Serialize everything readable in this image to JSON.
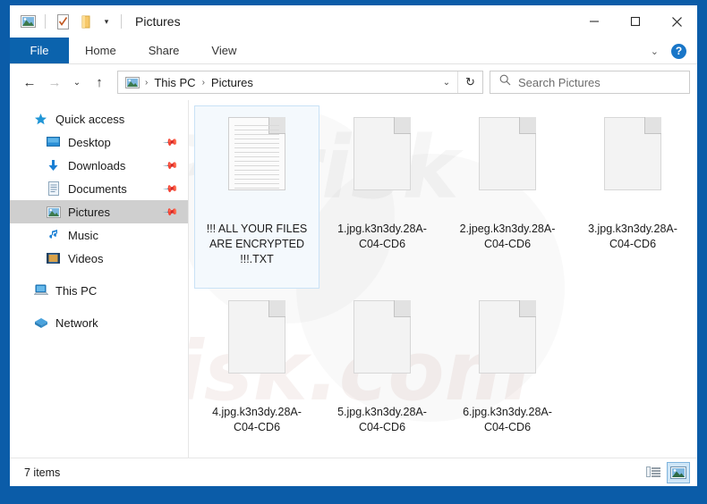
{
  "window": {
    "title": "Pictures",
    "border_color": "#0b5ca8",
    "accent_color": "#0b63ad"
  },
  "quick_access_toolbar": {
    "icons": [
      "pictures-folder-icon",
      "properties-icon",
      "new-folder-icon"
    ],
    "dropdown_glyph": "▾"
  },
  "window_controls": {
    "minimize": "minimize-icon",
    "maximize": "maximize-icon",
    "close": "close-icon"
  },
  "ribbon": {
    "tabs": [
      {
        "label": "File",
        "active": true
      },
      {
        "label": "Home",
        "active": false
      },
      {
        "label": "Share",
        "active": false
      },
      {
        "label": "View",
        "active": false
      }
    ],
    "collapse_glyph": "⌄",
    "help_label": "?"
  },
  "navigation": {
    "back_glyph": "←",
    "forward_glyph": "→",
    "recent_glyph": "⌄",
    "up_glyph": "↑",
    "refresh_glyph": "↻",
    "dropdown_glyph": "⌄"
  },
  "address_bar": {
    "icon": "pictures-folder-icon",
    "crumbs": [
      "This PC",
      "Pictures"
    ],
    "separator": "›"
  },
  "search": {
    "placeholder": "Search Pictures",
    "icon": "search-icon",
    "value": ""
  },
  "sidebar": {
    "items": [
      {
        "label": "Quick access",
        "icon": "star-icon",
        "pinned": false,
        "selected": false,
        "indent": false
      },
      {
        "label": "Desktop",
        "icon": "desktop-icon",
        "pinned": true,
        "selected": false,
        "indent": true
      },
      {
        "label": "Downloads",
        "icon": "downloads-icon",
        "pinned": true,
        "selected": false,
        "indent": true
      },
      {
        "label": "Documents",
        "icon": "documents-icon",
        "pinned": true,
        "selected": false,
        "indent": true
      },
      {
        "label": "Pictures",
        "icon": "pictures-icon",
        "pinned": true,
        "selected": true,
        "indent": true
      },
      {
        "label": "Music",
        "icon": "music-icon",
        "pinned": false,
        "selected": false,
        "indent": true
      },
      {
        "label": "Videos",
        "icon": "videos-icon",
        "pinned": false,
        "selected": false,
        "indent": true
      },
      {
        "label": "This PC",
        "icon": "this-pc-icon",
        "pinned": false,
        "selected": false,
        "indent": false
      },
      {
        "label": "Network",
        "icon": "network-icon",
        "pinned": false,
        "selected": false,
        "indent": false
      }
    ],
    "pin_glyph": "📌"
  },
  "files": [
    {
      "name": "!!! ALL YOUR FILES ARE ENCRYPTED !!!.TXT",
      "icon": "text-document-icon",
      "selected": true
    },
    {
      "name": "1.jpg.k3n3dy.28A-C04-CD6",
      "icon": "blank-file-icon",
      "selected": false
    },
    {
      "name": "2.jpeg.k3n3dy.28A-C04-CD6",
      "icon": "blank-file-icon",
      "selected": false
    },
    {
      "name": "3.jpg.k3n3dy.28A-C04-CD6",
      "icon": "blank-file-icon",
      "selected": false
    },
    {
      "name": "4.jpg.k3n3dy.28A-C04-CD6",
      "icon": "blank-file-icon",
      "selected": false
    },
    {
      "name": "5.jpg.k3n3dy.28A-C04-CD6",
      "icon": "blank-file-icon",
      "selected": false
    },
    {
      "name": "6.jpg.k3n3dy.28A-C04-CD6",
      "icon": "blank-file-icon",
      "selected": false
    }
  ],
  "status_bar": {
    "item_count_text": "7 items",
    "views": [
      {
        "name": "details-view",
        "active": false
      },
      {
        "name": "large-icons-view",
        "active": true
      }
    ]
  },
  "watermark": {
    "line1": "PCrisk",
    "line2": "risk.com"
  }
}
